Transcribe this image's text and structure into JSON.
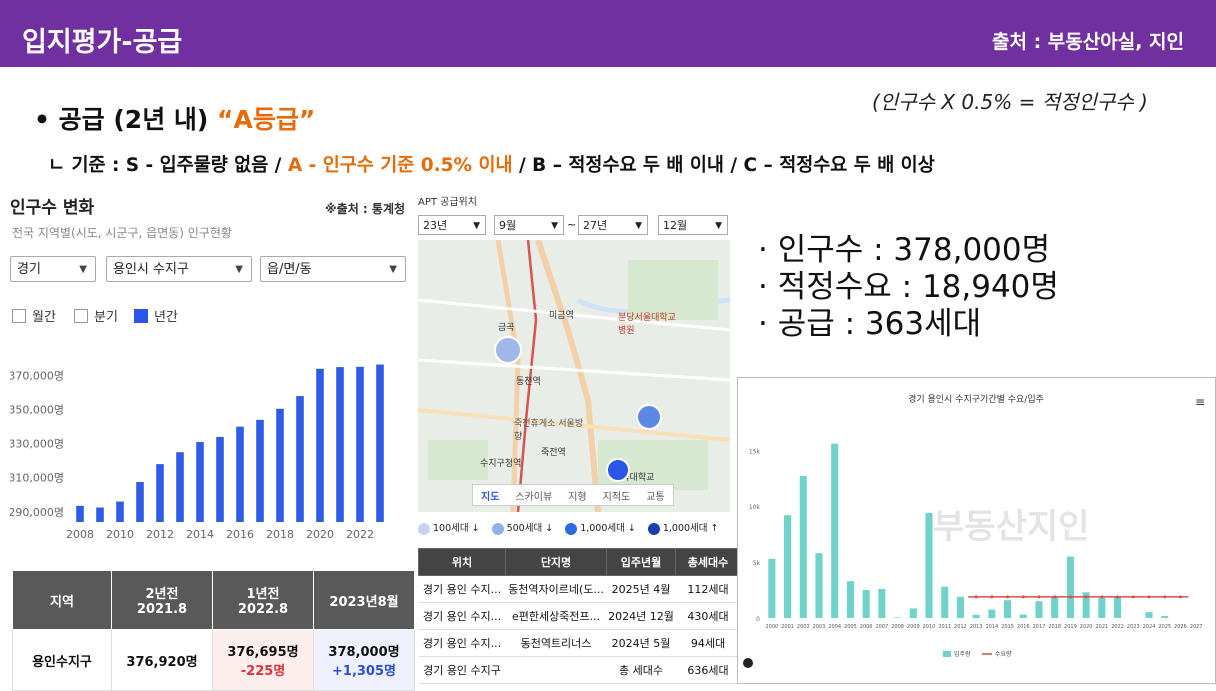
{
  "header": {
    "title": "입지평가-공급",
    "source": "출처 : 부동산아실, 지인"
  },
  "formula": "(인구수 X 0.5% = 적정인구수 )",
  "bullet": {
    "prefix": "• 공급 (2년 내) ",
    "grade": "“A등급”"
  },
  "criteria": {
    "part1": "ㄴ 기준 : S - 입주물량 없음 / ",
    "part2": "A - 인구수 기준 0.5% 이내",
    "part3": " / B – 적정수요 두 배 이내 / C – 적정수요 두 배 이상"
  },
  "population_panel": {
    "title": "인구수 변화",
    "source": "※출처 : 통계청",
    "subtitle": "전국 지역별(시도, 시군구, 읍면동) 인구현황",
    "selects": {
      "sido": "경기",
      "sigungu": "용인시 수지구",
      "dong": "읍/면/동"
    },
    "periods": [
      {
        "label": "월간",
        "checked": false
      },
      {
        "label": "분기",
        "checked": false
      },
      {
        "label": "년간",
        "checked": true
      }
    ],
    "table": {
      "headers": [
        "지역",
        "2년전",
        "2021.8",
        "1년전",
        "2022.8",
        "2023년8월"
      ],
      "region": "용인수지구",
      "v2021": "376,920명",
      "v2022": "376,695명",
      "d2022": "-225명",
      "v2023": "378,000명",
      "d2023": "+1,305명"
    }
  },
  "chart_data": [
    {
      "type": "bar",
      "title": "",
      "categories": [
        "2008",
        "2009",
        "2010",
        "2011",
        "2012",
        "2013",
        "2014",
        "2015",
        "2016",
        "2017",
        "2018",
        "2019",
        "2020",
        "2021",
        "2022",
        "2023"
      ],
      "values": [
        293500,
        292500,
        296000,
        307500,
        318000,
        325000,
        331000,
        334000,
        340000,
        344000,
        350500,
        358000,
        374000,
        375000,
        375200,
        376500
      ],
      "ytick_labels": [
        "370,000명",
        "350,000명",
        "330,000명",
        "310,000명",
        "290,000명"
      ],
      "xtick_labels": [
        "2008",
        "2010",
        "2012",
        "2014",
        "2016",
        "2018",
        "2020",
        "2022"
      ],
      "ylim": [
        284000,
        378000
      ],
      "color": "#2f5ce6"
    },
    {
      "type": "bar",
      "title": "경기 용인시 수지구기간별 수요/입주",
      "categories": [
        "2000",
        "2001",
        "2002",
        "2003",
        "2004",
        "2005",
        "2006",
        "2007",
        "2008",
        "2009",
        "2010",
        "2011",
        "2012",
        "2013",
        "2014",
        "2015",
        "2016",
        "2017",
        "2018",
        "2019",
        "2020",
        "2021",
        "2022",
        "2023",
        "2024",
        "2025",
        "2026",
        "2027"
      ],
      "values": [
        5300,
        9200,
        12700,
        5800,
        15600,
        3300,
        2500,
        2600,
        47,
        860,
        9400,
        2800,
        1900,
        288,
        751,
        1600,
        306,
        1500,
        1900,
        5500,
        2300,
        1800,
        1900,
        0,
        524,
        174,
        0,
        0
      ],
      "demand": 1890,
      "ytick_labels": [
        "15k",
        "10k",
        "5k",
        "0"
      ],
      "ylim": [
        0,
        17000
      ],
      "legend": [
        "입주량",
        "수요량"
      ],
      "color": "#6fd3c9",
      "line_color": "#d94c4c"
    }
  ],
  "map_panel": {
    "header": "APT 공급위치",
    "selects": [
      "23년",
      "9월",
      "27년",
      "12월"
    ],
    "tilde": "~",
    "places": [
      "미금역",
      "분당서울대학교병원",
      "동천역",
      "수지구청역",
      "죽전휴게소 서울방향",
      "죽전역",
      "단국대학교",
      "금곡"
    ],
    "tabs": [
      "지도",
      "스카이뷰",
      "지형",
      "지적도",
      "교통"
    ],
    "legend": [
      "100세대 ↓",
      "500세대 ↓",
      "1,000세대 ↓",
      "1,000세대 ↑"
    ],
    "table_headers": [
      "위치",
      "단지명",
      "입주년월",
      "총세대수"
    ],
    "rows": [
      {
        "loc": "경기 용인 수지...",
        "name": "동천역자이르네(도...",
        "date": "2025년 4월",
        "units": "112세대"
      },
      {
        "loc": "경기 용인 수지...",
        "name": "e편한세상죽전프...",
        "date": "2024년 12월",
        "units": "430세대"
      },
      {
        "loc": "경기 용인 수지...",
        "name": "동천역트리너스",
        "date": "2024년 5월",
        "units": "94세대"
      },
      {
        "loc": "경기 용인 수지구",
        "name": "",
        "date": "총 세대수",
        "units": "636세대"
      }
    ]
  },
  "stats": {
    "population": "· 인구수 : 378,000명",
    "demand": "· 적정수요 : 18,940명",
    "supply": "· 공급 : 363세대"
  },
  "watermark": "부동산지인"
}
